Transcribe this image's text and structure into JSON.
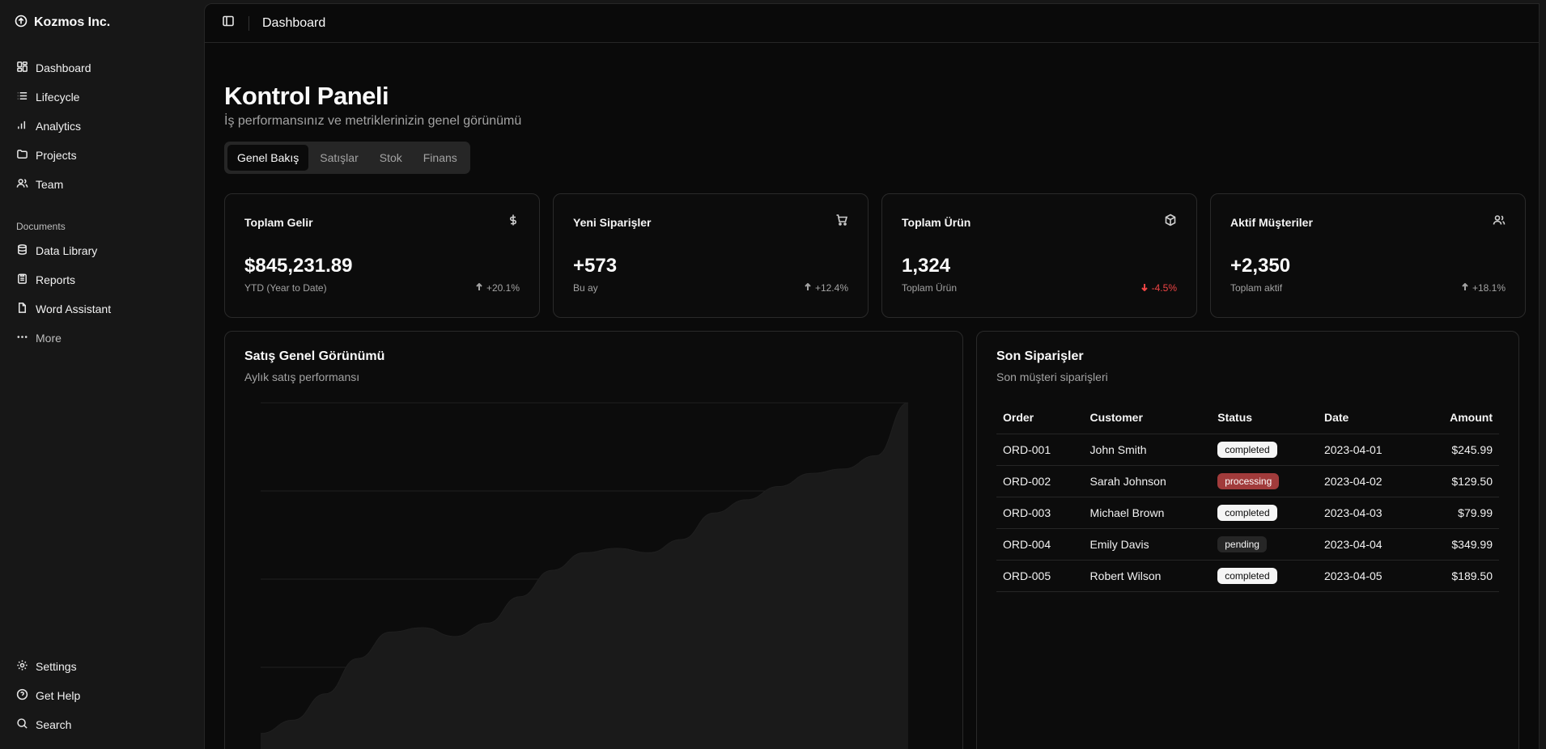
{
  "brand": {
    "name": "Kozmos Inc."
  },
  "sidebar": {
    "main_items": [
      {
        "label": "Dashboard",
        "icon": "dashboard-icon"
      },
      {
        "label": "Lifecycle",
        "icon": "list-icon"
      },
      {
        "label": "Analytics",
        "icon": "bar-chart-icon"
      },
      {
        "label": "Projects",
        "icon": "folder-icon"
      },
      {
        "label": "Team",
        "icon": "users-icon"
      }
    ],
    "documents_label": "Documents",
    "doc_items": [
      {
        "label": "Data Library",
        "icon": "database-icon"
      },
      {
        "label": "Reports",
        "icon": "clipboard-icon"
      },
      {
        "label": "Word Assistant",
        "icon": "file-icon"
      },
      {
        "label": "More",
        "icon": "ellipsis-icon"
      }
    ],
    "bottom_items": [
      {
        "label": "Settings",
        "icon": "gear-icon"
      },
      {
        "label": "Get Help",
        "icon": "help-icon"
      },
      {
        "label": "Search",
        "icon": "search-icon"
      }
    ]
  },
  "header": {
    "title": "Dashboard"
  },
  "page": {
    "title": "Kontrol Paneli",
    "subtitle": "İş performansınız ve metriklerinizin genel görünümü"
  },
  "tabs": [
    "Genel Bakış",
    "Satışlar",
    "Stok",
    "Finans"
  ],
  "active_tab": "Genel Bakış",
  "cards": [
    {
      "title": "Toplam Gelir",
      "icon": "dollar-icon",
      "value": "$845,231.89",
      "note": "YTD (Year to Date)",
      "delta": "+20.1%",
      "direction": "up"
    },
    {
      "title": "Yeni Siparişler",
      "icon": "cart-icon",
      "value": "+573",
      "note": "Bu ay",
      "delta": "+12.4%",
      "direction": "up"
    },
    {
      "title": "Toplam Ürün",
      "icon": "box-icon",
      "value": "1,324",
      "note": "Toplam Ürün",
      "delta": "-4.5%",
      "direction": "down"
    },
    {
      "title": "Aktif Müşteriler",
      "icon": "users-icon",
      "value": "+2,350",
      "note": "Toplam aktif",
      "delta": "+18.1%",
      "direction": "up"
    }
  ],
  "sales_panel": {
    "title": "Satış Genel Görünümü",
    "subtitle": "Aylık satış performansı"
  },
  "chart_data": {
    "type": "area",
    "title": "Satış Genel Görünümü",
    "xlabel": "",
    "ylabel": "",
    "grid": true,
    "values": [
      25,
      28,
      34,
      42,
      48,
      49,
      47,
      50,
      56,
      62,
      66,
      67,
      66,
      69,
      75,
      78,
      81,
      84,
      85,
      88,
      100
    ]
  },
  "orders_panel": {
    "title": "Son Siparişler",
    "subtitle": "Son müşteri siparişleri",
    "columns": [
      "Order",
      "Customer",
      "Status",
      "Date",
      "Amount"
    ],
    "rows": [
      {
        "order": "ORD-001",
        "customer": "John Smith",
        "status": "completed",
        "date": "2023-04-01",
        "amount": "$245.99"
      },
      {
        "order": "ORD-002",
        "customer": "Sarah Johnson",
        "status": "processing",
        "date": "2023-04-02",
        "amount": "$129.50"
      },
      {
        "order": "ORD-003",
        "customer": "Michael Brown",
        "status": "completed",
        "date": "2023-04-03",
        "amount": "$79.99"
      },
      {
        "order": "ORD-004",
        "customer": "Emily Davis",
        "status": "pending",
        "date": "2023-04-04",
        "amount": "$349.99"
      },
      {
        "order": "ORD-005",
        "customer": "Robert Wilson",
        "status": "completed",
        "date": "2023-04-05",
        "amount": "$189.50"
      }
    ]
  }
}
